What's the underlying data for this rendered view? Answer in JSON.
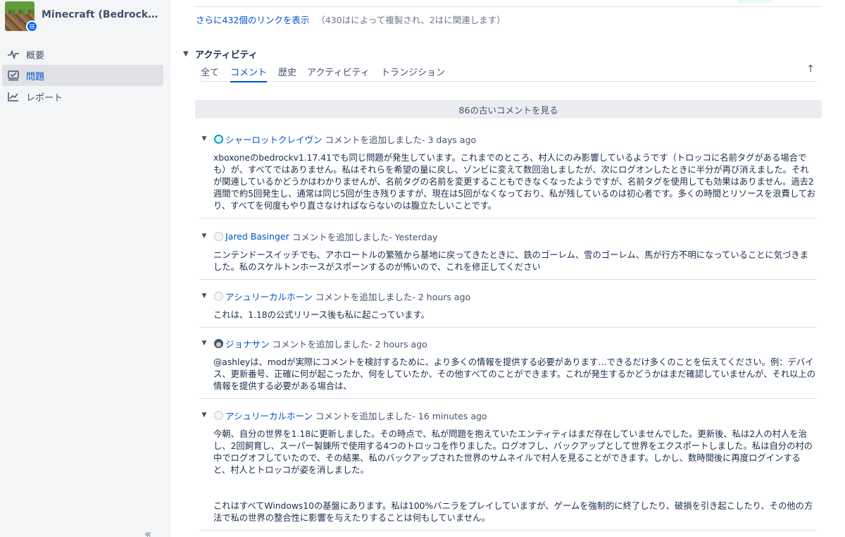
{
  "project": {
    "name": "Minecraft (Bedrock Edition)"
  },
  "sidebar": {
    "items": [
      {
        "label": "概要"
      },
      {
        "label": "問題"
      },
      {
        "label": "レポート"
      }
    ],
    "collapse_symbol": "«"
  },
  "links": {
    "more_label": "さらに432個のリンクを表示",
    "note": "（430はによって複製され、2はに関連します）"
  },
  "activity": {
    "title": "アクティビティ",
    "tabs": [
      {
        "label": "全て"
      },
      {
        "label": "コメント",
        "active": true
      },
      {
        "label": "歴史"
      },
      {
        "label": "アクティビティ"
      },
      {
        "label": "トランジション"
      }
    ],
    "older_comments": "86の古いコメントを見る"
  },
  "comments": [
    {
      "author": "シャーロットクレイヴン",
      "action": "コメントを追加しました- 3 days ago",
      "avatar": "teal-circle-icon",
      "body": [
        "xboxoneのbedrockv1.17.41でも同じ問題が発生しています。これまでのところ、村人にのみ影響しているようです（トロッコに名前タグがある場合でも）が、すべてではありません。私はそれらを希望の量に戻し、ゾンビに変えて数回治しましたが、次にログオンしたときに半分が再び消えました。それが関連しているかどうかはわかりませんが、名前タグの名前を変更することもできなくなったようですが、名前タグを使用しても効果はありません。過去2週間で約5回発生し、通常は同じ5回が生き残りますが、現在は5回がなくなっており、私が残しているのは初心者です。多くの時間とリソースを浪費しており、すべてを何度もやり直さなければならないのは腹立たしいことです。"
      ]
    },
    {
      "author": "Jared Basinger",
      "action": "コメントを追加しました- Yesterday",
      "avatar": "default-user-icon",
      "body": [
        "ニンテンドースイッチでも、アホロートルの繁殖から基地に戻ってきたときに、鉄のゴーレム、雪のゴーレム、馬が行方不明になっていることに気づきました。私のスケルトンホースがスポーンするのが怖いので、これを修正してください"
      ]
    },
    {
      "author": "アシュリーカルホーン",
      "action": "コメントを追加しました- 2 hours ago",
      "avatar": "default-user-icon",
      "body": [
        "これは、1.18の公式リリース後も私に起こっています。"
      ]
    },
    {
      "author": "ジョナサン",
      "action": "コメントを追加しました- 2 hours ago",
      "avatar": "user-photo-icon",
      "body": [
        "@ashleyは、modが実際にコメントを検討するために、より多くの情報を提供する必要があります…できるだけ多くのことを伝えてください。例：デバイス、更新番号、正確に何が起こったか、何をしていたか、その他すべてのことができます。これが発生するかどうかはまだ確認していませんが、それ以上の情報を提供する必要がある場合は、"
      ]
    },
    {
      "author": "アシュリーカルホーン",
      "action": "コメントを追加しました- 16 minutes ago",
      "avatar": "default-user-icon",
      "body": [
        "今朝、自分の世界を1.18に更新しました。その時点で、私が問題を抱えていたエンティティはまだ存在していませんでした。更新後、私は2人の村人を治し、2回飼育し、スーパー製錬所で使用する4つのトロッコを作りました。ログオフし、バックアップとして世界をエクスポートしました。私は自分の村の中でログオフしていたので、その結果、私のバックアップされた世界のサムネイルで村人を見ることができます。しかし、数時間後に再度ログインすると、村人とトロッコが姿を消しました。",
        "これはすべてWindows10の基盤にあります。私は100%バニラをプレイしていますが、ゲームを強制的に終了したり、破損を引き起こしたり、その他の方法で私の世界の整合性に影響を与えたりすることは何もしていません。"
      ]
    }
  ]
}
